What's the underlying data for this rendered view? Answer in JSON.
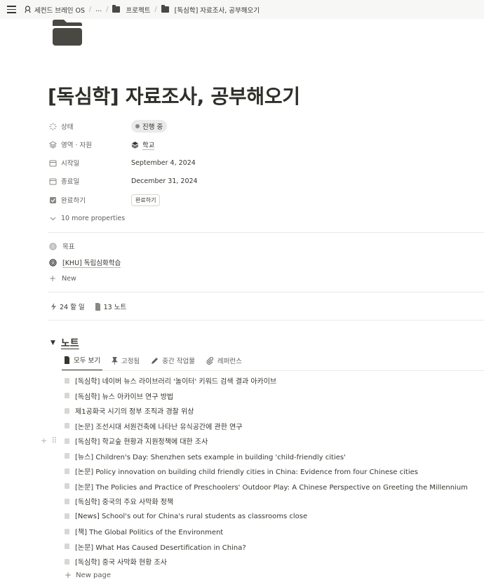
{
  "breadcrumb": {
    "workspace": "세컨드 브레인 OS",
    "ellipsis": "...",
    "parent": "프로젝트",
    "current": "[독심학] 자료조사, 공부해오기"
  },
  "page": {
    "title": "[독심학] 자료조사, 공부해오기",
    "icon": "folder-icon"
  },
  "properties": {
    "status": {
      "name": "상태",
      "value": "진행 중"
    },
    "area": {
      "name": "영역 · 자원",
      "value": "학교"
    },
    "start": {
      "name": "시작일",
      "value": "September 4, 2024"
    },
    "end": {
      "name": "종료일",
      "value": "December 31, 2024"
    },
    "done": {
      "name": "완료하기",
      "button": "완료하기"
    },
    "more": "10 more properties"
  },
  "goal": {
    "label": "목표",
    "item": "[KHU] 독립심화학습",
    "new": "New"
  },
  "counts": {
    "todo": "24 할 일",
    "notes": "13 노트"
  },
  "notes_section": {
    "title": "노트",
    "tabs": [
      "모두 보기",
      "고정됨",
      "중간 작업물",
      "레퍼런스"
    ],
    "items": [
      "[독심학] 네이버 뉴스 라이브러리 '놀이터' 키워드 검색 결과 아카이브",
      "[독심학] 뉴스 아카이브 연구 방법",
      "제1공화국 시기의 정부 조직과 경찰 위상",
      "[논문] 조선시대 서원건축에 나타난 유식공간에 관한 연구",
      "[독심학] 학교숲 현황과 지원정책에 대한 조사",
      "[뉴스] Children's Day: Shenzhen sets example in building 'child-friendly cities'",
      "[논문] Policy innovation on building child friendly cities in China: Evidence from four Chinese cities",
      "[논문] The Policies and Practice of Preschoolers' Outdoor Play: A Chinese Perspective on Greeting the Millennium",
      "[독심학] 중국의 주요 사막화 정책",
      "[News] School's out for China's rural students as classrooms close",
      "[책] The Global Politics of the Environment",
      "[논문] What Has Caused Desertification in China?",
      "[독심학] 중국 사막화 현황 조사"
    ],
    "new_page": "New page"
  }
}
